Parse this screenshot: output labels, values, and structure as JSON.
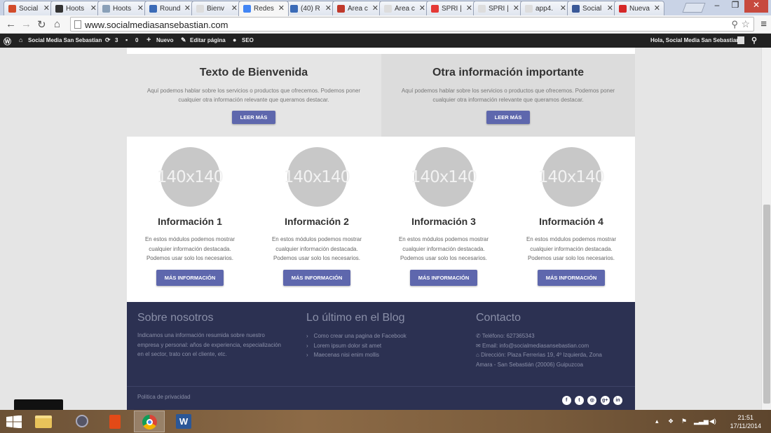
{
  "browser": {
    "tabs": [
      {
        "label": "Social",
        "fav_color": "#d24b2a"
      },
      {
        "label": "Hoots",
        "fav_color": "#333333"
      },
      {
        "label": "Hoots",
        "fav_color": "#8aa0b8"
      },
      {
        "label": "Round",
        "fav_color": "#3b6bb7"
      },
      {
        "label": "Bienv",
        "fav_color": "#dddddd"
      },
      {
        "label": "Redes",
        "fav_color": "#4285f4"
      },
      {
        "label": "(40) R",
        "fav_color": "#3b6bb7"
      },
      {
        "label": "Área c",
        "fav_color": "#c0392b"
      },
      {
        "label": "Área c",
        "fav_color": "#dddddd"
      },
      {
        "label": "SPRI |",
        "fav_color": "#e53935"
      },
      {
        "label": "SPRI |",
        "fav_color": "#dddddd"
      },
      {
        "label": "app4.",
        "fav_color": "#dddddd"
      },
      {
        "label": "Social",
        "fav_color": "#3b5998"
      },
      {
        "label": "Nueva",
        "fav_color": "#d62828"
      }
    ],
    "active_tab_index": 5,
    "url": "www.socialmediasansebastian.com",
    "window_controls": [
      "–",
      "❐",
      "✕"
    ]
  },
  "admin_bar": {
    "site_name": "Social Media San Sebastian",
    "updates_count": "3",
    "comments_count": "0",
    "new_label": "Nuevo",
    "edit_label": "Editar página",
    "seo_label": "SEO",
    "greeting": "Hola, Social Media San Sebastian"
  },
  "welcome": {
    "left": {
      "title": "Texto de Bienvenida",
      "text": "Aquí podemos hablar sobre los servicios o productos que ofrecemos. Podemos poner cualquier otra información relevante que queramos destacar.",
      "button": "LEER MÁS"
    },
    "right": {
      "title": "Otra información importante",
      "text": "Aquí podemos hablar sobre los servicios o productos que ofrecemos. Podemos poner cualquier otra información relevante que queramos destacar.",
      "button": "LEER MÁS"
    }
  },
  "features": [
    {
      "image": "140x140",
      "title": "Información 1",
      "text": "En estos módulos podemos mostrar cualquier información destacada. Podemos usar solo los necesarios.",
      "button": "MÁS INFORMACIÓN"
    },
    {
      "image": "140x140",
      "title": "Información 2",
      "text": "En estos módulos podemos mostrar cualquier información destacada. Podemos usar solo los necesarios.",
      "button": "MÁS INFORMACIÓN"
    },
    {
      "image": "140x140",
      "title": "Información 3",
      "text": "En estos módulos podemos mostrar cualquier información destacada. Podemos usar solo los necesarios.",
      "button": "MÁS INFORMACIÓN"
    },
    {
      "image": "140x140",
      "title": "Información 4",
      "text": "En estos módulos podemos mostrar cualquier información destacada. Podemos usar solo los necesarios.",
      "button": "MÁS INFORMACIÓN"
    }
  ],
  "footer": {
    "about_title": "Sobre nosotros",
    "about_text": "Indicamos una información resumida sobre nuestro empresa y personal: años de experiencia, especialización en el sector, trato con el cliente, etc.",
    "blog_title": "Lo último en el Blog",
    "blog_posts": [
      "Como crear una pagina de Facebook",
      "Lorem ipsum dolor sit amet",
      "Maecenas nisi enim mollis"
    ],
    "contact_title": "Contacto",
    "phone": "Teléfono: 627365343",
    "email": "Email: info@socialmediasansebastian.com",
    "address": "Dirección: Plaza Ferrerias 19, 4º Izquierda, Zona Amara - San Sebastián (20006) Guipuzcoa",
    "privacy": "Politica de privacidad",
    "social_icons": [
      "facebook-icon",
      "twitter-icon",
      "instagram-icon",
      "google-plus-icon",
      "linkedin-icon"
    ]
  },
  "taskbar": {
    "time": "21:51",
    "date": "17/11/2014",
    "apps": [
      "file-explorer-icon",
      "app-icon",
      "office-icon",
      "chrome-icon",
      "word-icon"
    ]
  },
  "colors": {
    "button": "#5e67ad",
    "footer_bg": "#2c3152",
    "page_bg": "#e5e5e5"
  }
}
